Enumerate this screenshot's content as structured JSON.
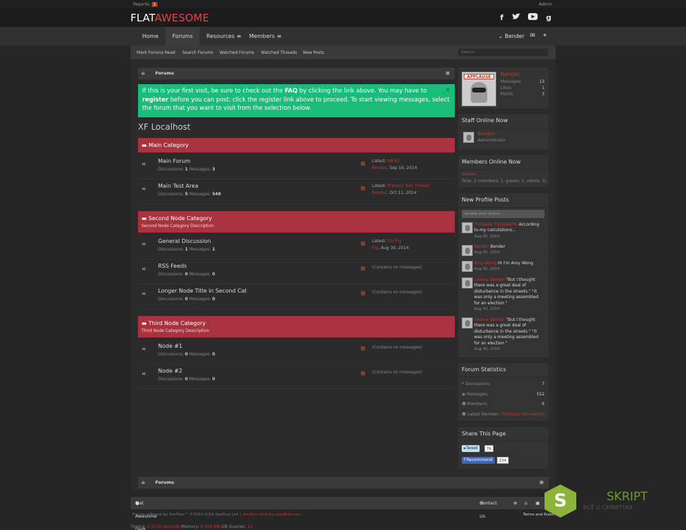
{
  "topbar": {
    "reports_label": "Reports:",
    "reports_count": "1",
    "admin": "Admin"
  },
  "logo": {
    "part1": "FLAT",
    "part2": "AWESOME"
  },
  "social": [
    "facebook-icon",
    "twitter-icon",
    "youtube-icon",
    "google-plus-icon"
  ],
  "nav": {
    "home": "Home",
    "forums": "Forums",
    "resources": "Resources",
    "members": "Members",
    "menu_glyph": "≡",
    "user": "Bender"
  },
  "subnav": {
    "mark_read": "Mark Forums Read",
    "search_forums": "Search Forums",
    "watched_forums": "Watched Forums",
    "watched_threads": "Watched Threads",
    "new_posts": "New Posts",
    "search_placeholder": "Search..."
  },
  "breadcrumb": {
    "label": "Forums"
  },
  "notice": {
    "p1": "If this is your first visit, be sure to check out the ",
    "faq": "FAQ",
    "p2": " by clicking the link above. You may have to ",
    "register": "register",
    "p3": " before you can post: click the register link above to proceed. To start viewing messages, select the forum that you want to visit from the selection below.",
    "close": "×"
  },
  "page_title": "XF Localhost",
  "categories": [
    {
      "title": "Main Category",
      "desc": ""
    },
    {
      "title": "Second Node Category",
      "desc": "Second Node Category Description"
    },
    {
      "title": "Third Node Category",
      "desc": "Third Node Category Description"
    }
  ],
  "nodes": [
    {
      "name": "Main Forum",
      "disc": "1",
      "msgs": "3",
      "latest": "MESO",
      "by": "Bender",
      "date": ", Sep 16, 2014"
    },
    {
      "name": "Main Test Area",
      "disc": "5",
      "msgs": "548",
      "latest": "Primary Test Thread",
      "by": "Bender",
      "date": ", Oct 11, 2014"
    },
    {
      "name": "General Discussion",
      "disc": "1",
      "msgs": "1",
      "latest": "I'm Fry",
      "by": "Fry",
      "date": ", Aug 30, 2014"
    },
    {
      "name": "RSS Feeds",
      "disc": "0",
      "msgs": "0",
      "none": "(Contains no messages)"
    },
    {
      "name": "Longer Node Title in Second Cat",
      "disc": "0",
      "msgs": "0",
      "none": "(Contains no messages)"
    },
    {
      "name": "Node #1",
      "disc": "0",
      "msgs": "0",
      "none": "(Contains no messages)"
    },
    {
      "name": "Node #2",
      "disc": "0",
      "msgs": "0",
      "none": "(Contains no messages)"
    }
  ],
  "labels": {
    "discussions": "Discussions:",
    "messages": "Messages:",
    "latest": "Latest:"
  },
  "visitor": {
    "avatar_text": "APPLAUSE",
    "name": "Bender",
    "messages_label": "Messages:",
    "messages": "13",
    "likes_label": "Likes:",
    "likes": "1",
    "points_label": "Points:",
    "points": "3"
  },
  "staff": {
    "title": "Staff Online Now",
    "name": "Bender",
    "role": "Administrator"
  },
  "online": {
    "title": "Members Online Now",
    "name": "Bender",
    "total": "Total: 2 (members: 1, guests: 1, robots: 0)"
  },
  "profile_posts": {
    "title": "New Profile Posts",
    "placeholder": "Update your status...",
    "posts": [
      {
        "author": "Professor Farnsworth",
        "to": "",
        "text": " According to my calculations...",
        "date": "Aug 30, 2014"
      },
      {
        "author": "Bender",
        "to": "",
        "text": " Bender",
        "date": "Aug 30, 2014"
      },
      {
        "author": "Amy Wong",
        "to": "",
        "text": " Hi I'm Amy Wong",
        "date": "Aug 30, 2014"
      },
      {
        "author": "Leela",
        "to": "Bender",
        "text": " \"But I thought there was a great deal of disturbance in the streets.\" \"It was only a meeting assembled for an election.\"",
        "date": "Aug 30, 2014"
      },
      {
        "author": "Leela",
        "to": "Bender",
        "text": " \"But I thought there was a great deal of disturbance in the streets.\" \"It was only a meeting assembled for an election.\"",
        "date": "Aug 30, 2014"
      }
    ]
  },
  "stats": {
    "title": "Forum Statistics",
    "discussions_label": "Discussions:",
    "discussions": "7",
    "messages_label": "Messages:",
    "messages": "552",
    "members_label": "Members:",
    "members": "6",
    "latest_label": "Latest Member:",
    "latest": "Professor Farnsworth"
  },
  "share": {
    "title": "Share This Page",
    "tweet": "Tweet",
    "tweet_count": "76",
    "recommend": "Recommend",
    "recommend_count": "234"
  },
  "footer": {
    "style": "Flat Awesome Dark",
    "contact": "Contact Us",
    "terms": "Terms and Rules",
    "copy1": "Forum software by XenForo™ ©2010-2014 XenForo Ltd. | ",
    "copy2": "XenForo style by pixelExit.com"
  },
  "timing": {
    "l1": "Timing: ",
    "t": "0.1170 seconds",
    "l2": " Memory: ",
    "m": "6.099 MB",
    "l3": " DB Queries: ",
    "q": "11"
  },
  "watermark": {
    "letter": "S",
    "name": "SKRIPT",
    "sub": "ВСЁ О СКРИПТАХ"
  },
  "colors": {
    "accent": "#e0454b",
    "category": "#a8333f",
    "notice": "#1abc7a",
    "watermark": "#8db33a"
  }
}
